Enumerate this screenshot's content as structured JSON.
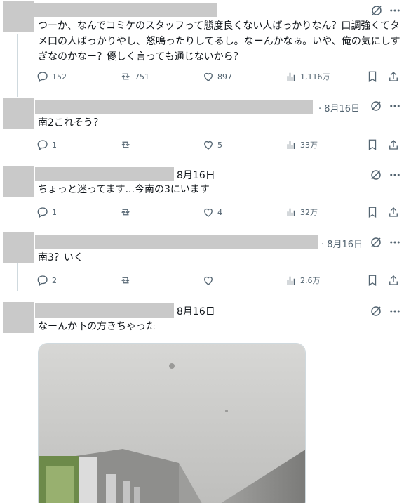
{
  "tweets": [
    {
      "text": "つーか、なんでコミケのスタッフって態度良くない人ばっかりなん？口調強くてタメ口の人ばっかりやし、怒鳴ったりしてるし。なーんかなぁ。いや、俺の気にしすぎなのかなー？優しく言っても通じないから？",
      "replies": "152",
      "reposts": "751",
      "likes": "897",
      "views": "1,116万"
    },
    {
      "date": "· 8月16日",
      "text": "南2これそう？",
      "replies": "1",
      "reposts": "",
      "likes": "5",
      "views": "33万"
    },
    {
      "date": "8月16日",
      "text": "ちょっと迷ってます...今南の3にいます",
      "replies": "1",
      "reposts": "",
      "likes": "4",
      "views": "32万"
    },
    {
      "date": "· 8月16日",
      "text": "南3？いく",
      "replies": "2",
      "reposts": "",
      "likes": "",
      "views": "2.6万"
    },
    {
      "date": "8月16日",
      "text": "なーんか下の方きちゃった"
    }
  ],
  "icons": [
    "grok-icon",
    "more-icon",
    "reply-icon",
    "repost-icon",
    "like-icon",
    "views-icon",
    "bookmark-icon",
    "share-icon"
  ]
}
